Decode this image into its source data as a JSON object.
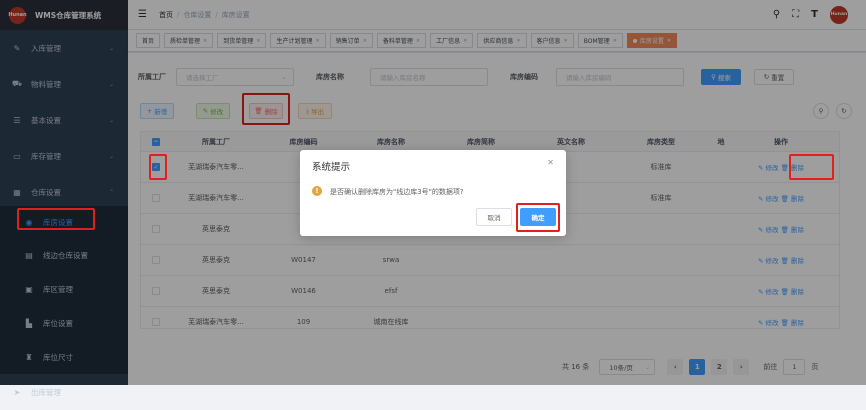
{
  "app": {
    "logo_text": "Hunan",
    "title": "WMS仓库管理系统"
  },
  "sidebar": {
    "items": [
      {
        "label": "入库管理",
        "icon": "edit-icon"
      },
      {
        "label": "物料管理",
        "icon": "cart-icon"
      },
      {
        "label": "基本设置",
        "icon": "list-icon"
      },
      {
        "label": "库存管理",
        "icon": "monitor-icon"
      },
      {
        "label": "仓库设置",
        "icon": "grid-icon"
      }
    ],
    "subitems": [
      {
        "label": "库房设置",
        "icon": "github-icon"
      },
      {
        "label": "线边仓库设置",
        "icon": "table-icon"
      },
      {
        "label": "库区管理",
        "icon": "box-icon"
      },
      {
        "label": "库位设置",
        "icon": "position-icon"
      },
      {
        "label": "库位尺寸",
        "icon": "ruler-icon"
      }
    ],
    "bottom_item": {
      "label": "出库管理",
      "icon": "send-icon"
    }
  },
  "breadcrumb": {
    "home": "首页",
    "level1": "仓库设置",
    "level2": "库房设置"
  },
  "tags": [
    "首页",
    "质检单管理",
    "到货单管理",
    "生产计划管理",
    "销售订单",
    "备料单管理",
    "工厂信息",
    "供应商信息",
    "客户信息",
    "BOM管理",
    "库房设置"
  ],
  "filters": {
    "factory_label": "所属工厂",
    "factory_placeholder": "请选择工厂",
    "name_label": "库房名称",
    "name_placeholder": "请输入库房名称",
    "code_label": "库房编码",
    "code_placeholder": "请输入库房编码",
    "search": "搜索",
    "reset": "重置"
  },
  "toolbar": {
    "add": "新增",
    "edit": "修改",
    "delete": "删除",
    "export": "导出"
  },
  "table": {
    "headers": [
      "所属工厂",
      "库房编码",
      "库房名称",
      "库房简称",
      "英文名称",
      "库房类型",
      "地",
      "操作"
    ],
    "rows": [
      {
        "factory": "芜湖瑞泰汽车零...",
        "code": "W",
        "name": "",
        "short": "",
        "en": "",
        "type": "标准库",
        "checked": true
      },
      {
        "factory": "芜湖瑞泰汽车零...",
        "code": "W",
        "name": "",
        "short": "",
        "en": "",
        "type": "标准库",
        "checked": false
      },
      {
        "factory": "英思泰克",
        "code": "W",
        "name": "",
        "short": "",
        "en": "",
        "type": "",
        "checked": false
      },
      {
        "factory": "英思泰克",
        "code": "W0147",
        "name": "srwa",
        "short": "",
        "en": "",
        "type": "",
        "checked": false
      },
      {
        "factory": "英思泰克",
        "code": "W0146",
        "name": "efsf",
        "short": "",
        "en": "",
        "type": "",
        "checked": false
      },
      {
        "factory": "芜湖瑞泰汽车零...",
        "code": "109",
        "name": "城南在线库",
        "short": "",
        "en": "",
        "type": "",
        "checked": false
      }
    ],
    "edit": "修改",
    "delete": "删除"
  },
  "pagination": {
    "total": "共 16 条",
    "size": "10条/页",
    "pages": [
      "1",
      "2"
    ],
    "goto": "前往",
    "page_input": "1",
    "page_suffix": "页"
  },
  "dialog": {
    "title": "系统提示",
    "message": "是否确认删除库房为\"线边库3号\"的数据项?",
    "cancel": "取消",
    "confirm": "确定"
  },
  "colors": {
    "primary": "#409eff",
    "sidebar": "#304156",
    "danger": "#e02020",
    "tag_active": "#f08a5d"
  }
}
